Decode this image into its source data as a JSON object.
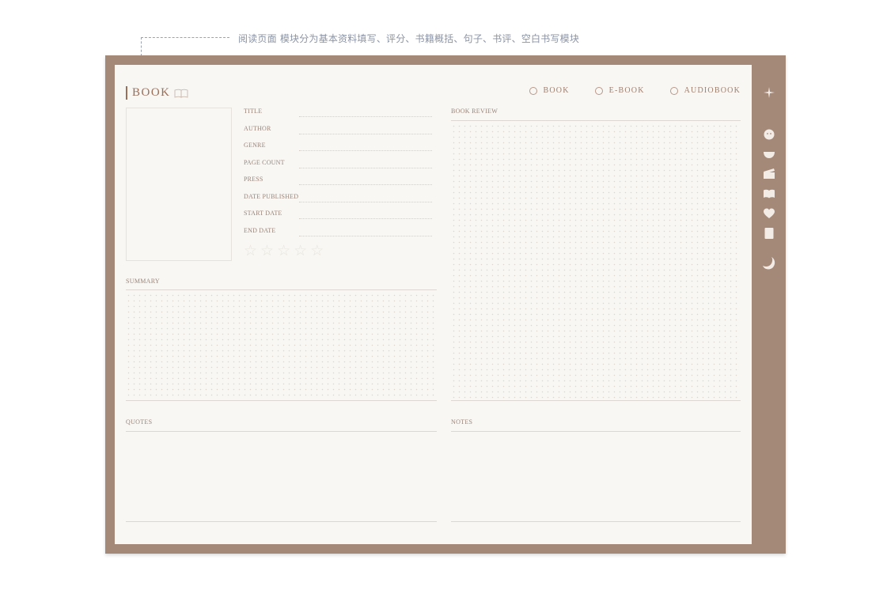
{
  "annotation": {
    "text": "阅读页面 模块分为基本资料填写、评分、书籍概括、句子、书评、空白书写模块"
  },
  "header": {
    "title": "BOOK",
    "title_icon": "open-book-outline-icon"
  },
  "formats": [
    {
      "label": "BOOK"
    },
    {
      "label": "E-BOOK"
    },
    {
      "label": "AUDIOBOOK"
    }
  ],
  "fields": [
    {
      "label": "TITLE"
    },
    {
      "label": "AUTHOR"
    },
    {
      "label": "GENRE"
    },
    {
      "label": "PAGE COUNT"
    },
    {
      "label": "PRESS"
    },
    {
      "label": "DATE PUBLISHED"
    },
    {
      "label": "START DATE"
    },
    {
      "label": "END DATE"
    }
  ],
  "rating": {
    "max": 5,
    "filled": 0
  },
  "sections": {
    "summary": "SUMMARY",
    "book_review": "BOOK REVIEW",
    "quotes": "QUOTES",
    "notes": "NOTES"
  },
  "side_icons": [
    "sparkle-icon",
    "face-icon",
    "bowl-icon",
    "clapperboard-icon",
    "open-book-icon",
    "heart-icon",
    "notebook-icon",
    "moon-icon"
  ],
  "colors": {
    "frame": "#a48878",
    "paper": "#f8f7f4",
    "accent": "#9a6f5a"
  }
}
